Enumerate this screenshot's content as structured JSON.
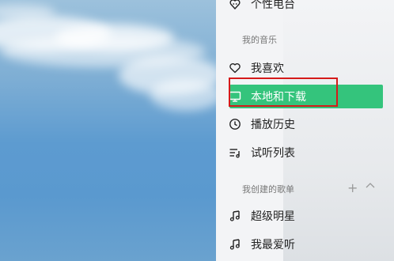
{
  "sidebar": {
    "top_item": {
      "label": "个性电台",
      "icon": "radio-icon"
    },
    "section_my_music": "我的音乐",
    "items": [
      {
        "label": "我喜欢",
        "icon": "heart-icon"
      },
      {
        "label": "本地和下载",
        "icon": "monitor-icon",
        "active": true
      },
      {
        "label": "播放历史",
        "icon": "clock-icon"
      },
      {
        "label": "试听列表",
        "icon": "playlist-icon"
      }
    ],
    "section_created": "我创建的歌单",
    "created_add": "+",
    "created_collapse": "^",
    "playlists": [
      {
        "label": "超级明星",
        "icon": "music-note-icon"
      },
      {
        "label": "我最爱听",
        "icon": "music-note-icon"
      }
    ]
  },
  "colors": {
    "active_bg": "#34c47c",
    "highlight_border": "#d51a1a",
    "sidebar_bg": "#f3f4f6"
  }
}
